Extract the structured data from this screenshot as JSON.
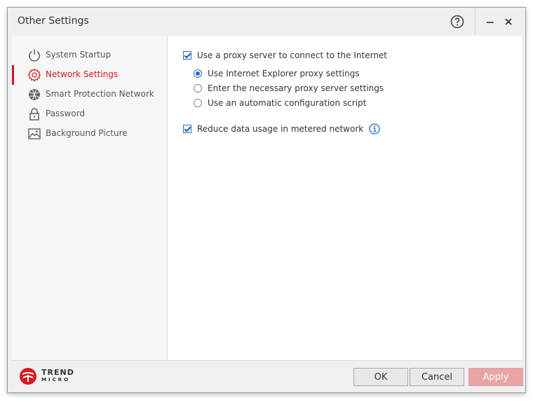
{
  "window": {
    "title": "Other Settings"
  },
  "titlebar": {
    "help_icon": "question-circle-icon",
    "minimize_icon": "minimize-icon",
    "close_icon": "close-icon"
  },
  "sidebar": {
    "items": [
      {
        "label": "System Startup",
        "icon": "power-icon",
        "active": false
      },
      {
        "label": "Network Settings",
        "icon": "gear-icon",
        "active": true
      },
      {
        "label": "Smart Protection Network",
        "icon": "globe-icon",
        "active": false
      },
      {
        "label": "Password",
        "icon": "lock-icon",
        "active": false
      },
      {
        "label": "Background Picture",
        "icon": "picture-icon",
        "active": false
      }
    ]
  },
  "network": {
    "use_proxy": {
      "label": "Use a proxy server to connect to the Internet",
      "checked": true
    },
    "proxy_options": [
      {
        "label": "Use Internet Explorer proxy settings",
        "selected": true
      },
      {
        "label": "Enter the necessary proxy server settings",
        "selected": false
      },
      {
        "label": "Use an automatic configuration script",
        "selected": false
      }
    ],
    "reduce_data": {
      "label": "Reduce data usage in metered network",
      "checked": true,
      "info_icon": "info-icon"
    }
  },
  "footer": {
    "brand_line1": "TREND",
    "brand_line2": "MICRO",
    "ok_label": "OK",
    "cancel_label": "Cancel",
    "apply_label": "Apply"
  },
  "colors": {
    "accent": "#d71920",
    "link_blue": "#1c6fc7",
    "apply_disabled": "#e9a4a6"
  }
}
